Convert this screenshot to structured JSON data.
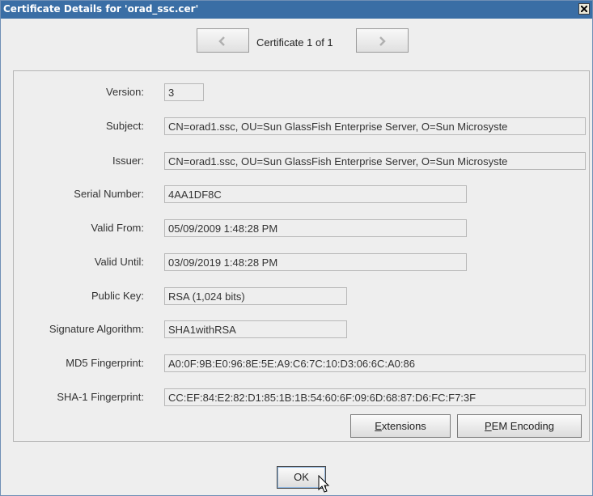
{
  "window": {
    "title": "Certificate Details for 'orad_ssc.cer'",
    "close_icon": "close-icon"
  },
  "navigation": {
    "prev_icon": "chevron-left-icon",
    "next_icon": "chevron-right-icon",
    "counter": "Certificate 1 of 1"
  },
  "fields": {
    "version": {
      "label": "Version:",
      "value": "3"
    },
    "subject": {
      "label": "Subject:",
      "value": "CN=orad1.ssc, OU=Sun GlassFish Enterprise Server, O=Sun Microsyste"
    },
    "issuer": {
      "label": "Issuer:",
      "value": "CN=orad1.ssc, OU=Sun GlassFish Enterprise Server, O=Sun Microsyste"
    },
    "serial_number": {
      "label": "Serial Number:",
      "value": "4AA1DF8C"
    },
    "valid_from": {
      "label": "Valid From:",
      "value": "05/09/2009 1:48:28 PM"
    },
    "valid_until": {
      "label": "Valid Until:",
      "value": "03/09/2019 1:48:28 PM"
    },
    "public_key": {
      "label": "Public Key:",
      "value": "RSA (1,024 bits)"
    },
    "signature_algorithm": {
      "label": "Signature Algorithm:",
      "value": "SHA1withRSA"
    },
    "md5_fingerprint": {
      "label": "MD5 Fingerprint:",
      "value": "A0:0F:9B:E0:96:8E:5E:A9:C6:7C:10:D3:06:6C:A0:86"
    },
    "sha1_fingerprint": {
      "label": "SHA-1 Fingerprint:",
      "value": "CC:EF:84:E2:82:D1:85:1B:1B:54:60:6F:09:6D:68:87:D6:FC:F7:3F"
    }
  },
  "buttons": {
    "extensions_mnemonic": "E",
    "extensions_rest": "xtensions",
    "pem_mnemonic": "P",
    "pem_rest": "EM Encoding",
    "ok": "OK"
  },
  "colors": {
    "titlebar": "#3a6ea5",
    "dialog_background": "#eeeeee"
  }
}
